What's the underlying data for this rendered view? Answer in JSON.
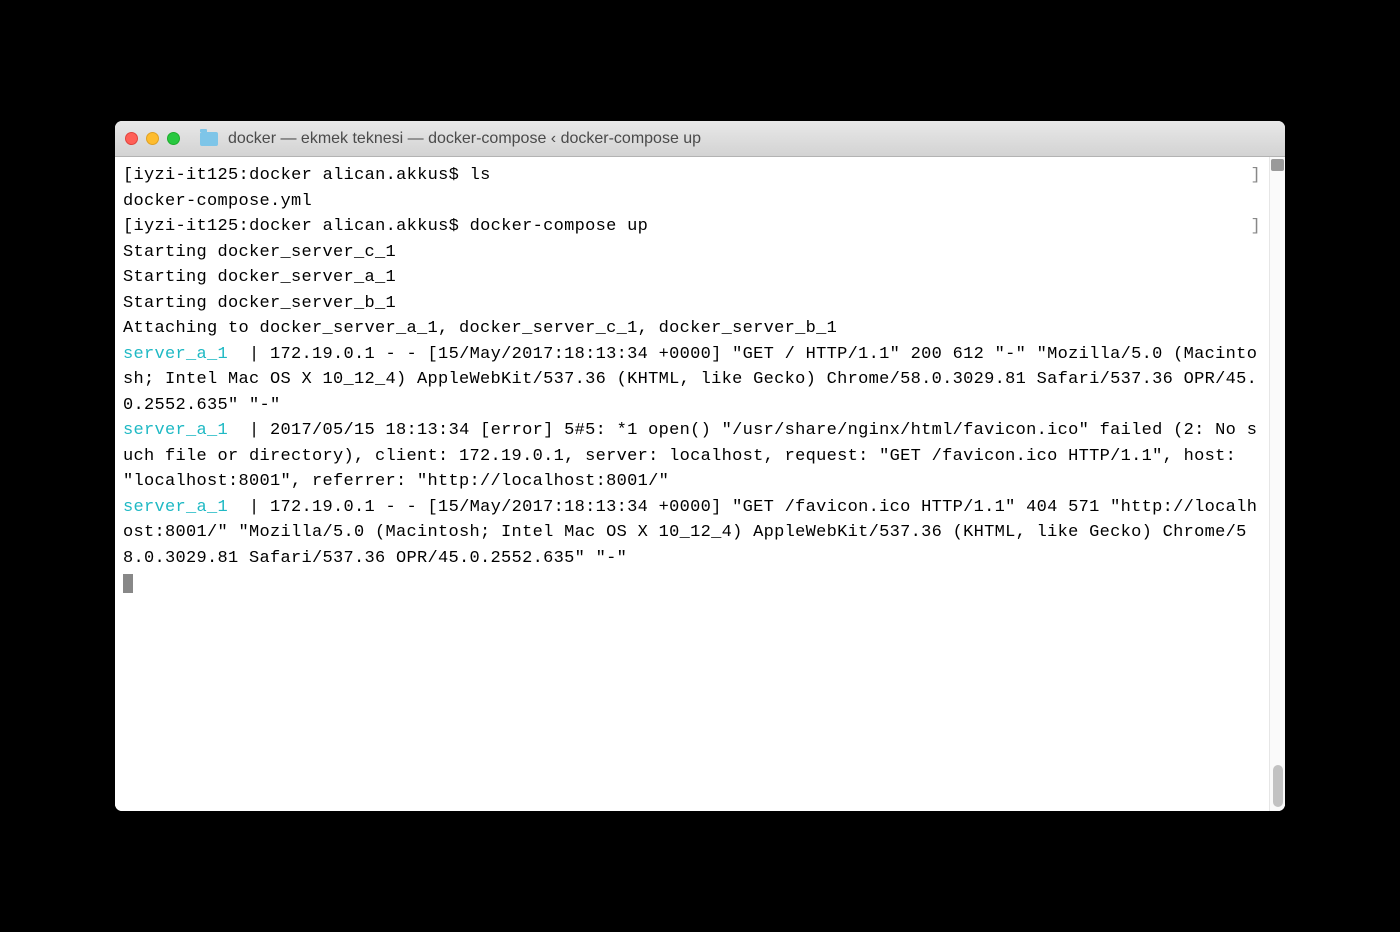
{
  "titlebar": {
    "title": "docker — ekmek teknesi — docker-compose ‹ docker-compose up"
  },
  "prompt": {
    "host": "iyzi-it125",
    "folder": "docker",
    "user": "alican.akkus",
    "symbol": "$"
  },
  "commands": {
    "ls": "ls",
    "compose_up": "docker-compose up"
  },
  "ls_output": "docker-compose.yml",
  "starting": [
    "Starting docker_server_c_1",
    "Starting docker_server_a_1",
    "Starting docker_server_b_1"
  ],
  "attaching": "Attaching to docker_server_a_1, docker_server_c_1, docker_server_b_1",
  "log_prefix": "server_a_1  ",
  "logs": {
    "line1": "| 172.19.0.1 - - [15/May/2017:18:13:34 +0000] \"GET / HTTP/1.1\" 200 612 \"-\" \"Mozilla/5.0 (Macintosh; Intel Mac OS X 10_12_4) AppleWebKit/537.36 (KHTML, like Gecko) Chrome/58.0.3029.81 Safari/537.36 OPR/45.0.2552.635\" \"-\"",
    "line2": "| 2017/05/15 18:13:34 [error] 5#5: *1 open() \"/usr/share/nginx/html/favicon.ico\" failed (2: No such file or directory), client: 172.19.0.1, server: localhost, request: \"GET /favicon.ico HTTP/1.1\", host: \"localhost:8001\", referrer: \"http://localhost:8001/\"",
    "line3": "| 172.19.0.1 - - [15/May/2017:18:13:34 +0000] \"GET /favicon.ico HTTP/1.1\" 404 571 \"http://localhost:8001/\" \"Mozilla/5.0 (Macintosh; Intel Mac OS X 10_12_4) AppleWebKit/537.36 (KHTML, like Gecko) Chrome/58.0.3029.81 Safari/537.36 OPR/45.0.2552.635\" \"-\""
  },
  "brackets": {
    "open": "[",
    "close": "]"
  }
}
